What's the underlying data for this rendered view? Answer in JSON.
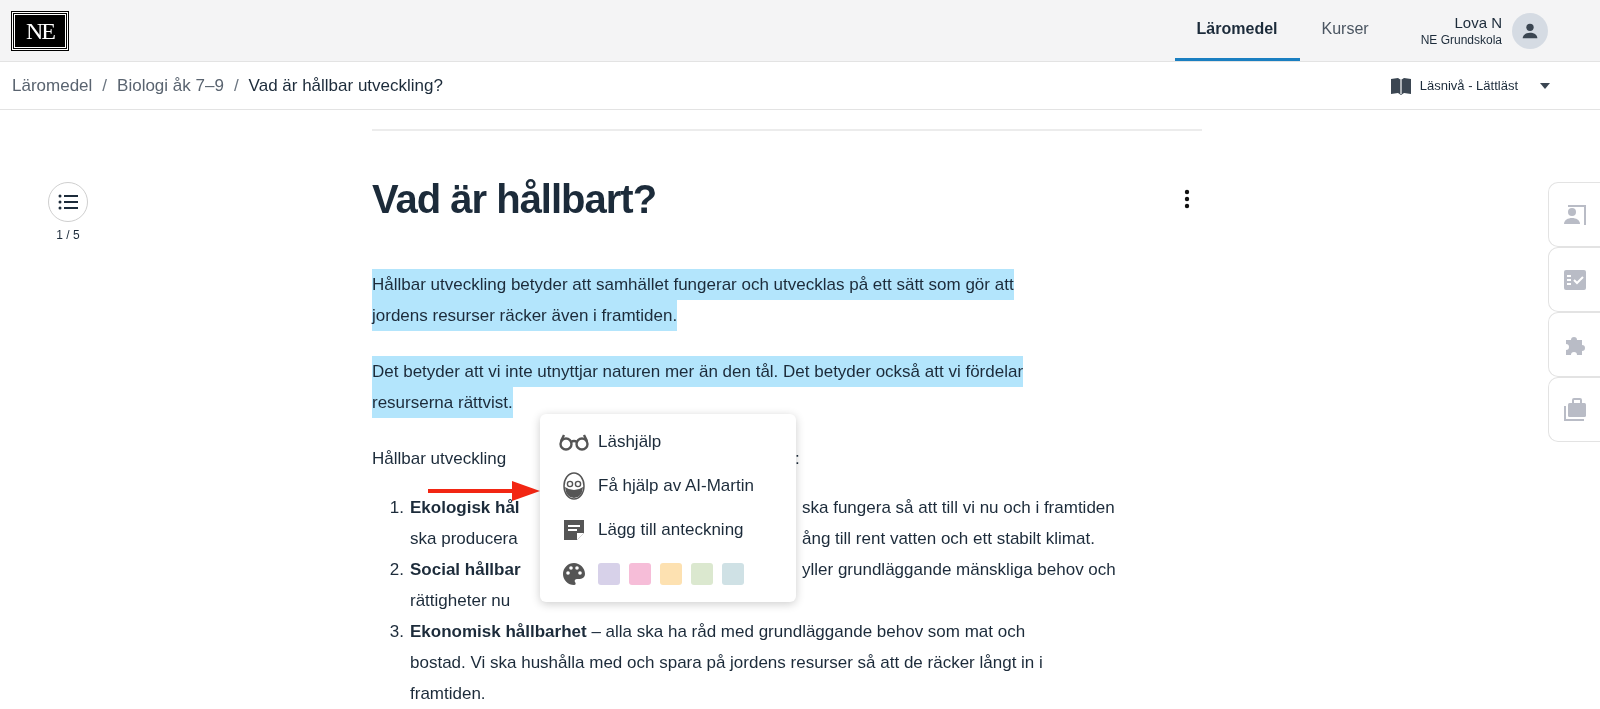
{
  "header": {
    "logo": "NE",
    "nav": [
      {
        "label": "Läromedel",
        "selected": true
      },
      {
        "label": "Kurser",
        "selected": false
      }
    ],
    "user": {
      "name": "Lova N",
      "school": "NE Grundskola"
    }
  },
  "breadcrumb": {
    "items": [
      "Läromedel",
      "Biologi åk 7–9",
      "Vad är hållbar utveckling?"
    ],
    "separator": "/"
  },
  "reading_level": "Läsnivå - Lättläst",
  "toc": {
    "progress": "1 / 5"
  },
  "title": "Vad är hållbart?",
  "paragraphs": [
    {
      "lines": [
        "Hållbar utveckling betyder att samhället fungerar och utvecklas på ett sätt som gör att",
        "jordens resurser räcker även i framtiden."
      ],
      "highlighted": true
    },
    {
      "lines": [
        "Det betyder att vi inte utnyttjar naturen mer än den tål. Det betyder också att vi fördelar",
        "resurserna rättvist."
      ],
      "highlighted": true
    }
  ],
  "intro": {
    "left": "Hållbar utveckling",
    "right": ":"
  },
  "list": [
    {
      "number": "1.",
      "lines": [
        {
          "left": "**Ekologisk hål**",
          "right": "ska fungera så att till vi nu och i framtiden"
        },
        {
          "left": "ska producera",
          "right": "ång till rent vatten och ett stabilt klimat."
        }
      ]
    },
    {
      "number": "2.",
      "lines": [
        {
          "left": "**Social hållbar**",
          "right": "yller grundläggande mänskliga behov och"
        },
        {
          "left": "rättigheter nu"
        }
      ]
    },
    {
      "number": "3.",
      "lines": [
        {
          "left": "**Ekonomisk hållbarhet** – alla ska ha råd med grundläggande behov som mat och"
        },
        {
          "left": "bostad. Vi ska hushålla med och spara på jordens resurser så att de räcker långt in i"
        },
        {
          "left": "framtiden."
        }
      ]
    }
  ],
  "context_menu": {
    "items": [
      {
        "kind": "glasses",
        "label": "Läshjälp"
      },
      {
        "kind": "avatar",
        "label": "Få hjälp av AI-Martin"
      },
      {
        "kind": "note",
        "label": "Lägg till anteckning"
      }
    ],
    "highlight_colors": [
      {
        "color": "#d7d1e9"
      },
      {
        "color": "#f6bdd8"
      },
      {
        "color": "#fde1b1"
      },
      {
        "color": "#dbe8cf"
      },
      {
        "color": "#cfe1e5"
      }
    ]
  },
  "side_tabs": [
    {
      "kind": "presenter"
    },
    {
      "kind": "checklist"
    },
    {
      "kind": "puzzle"
    },
    {
      "kind": "briefcase"
    }
  ]
}
